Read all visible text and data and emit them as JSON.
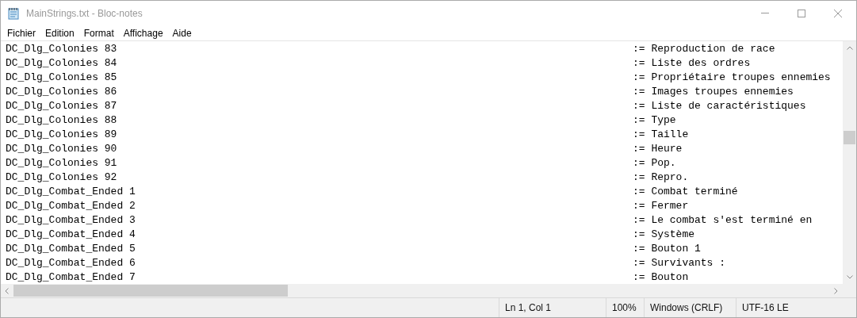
{
  "window": {
    "title": "MainStrings.txt - Bloc-notes"
  },
  "menu": [
    "Fichier",
    "Edition",
    "Format",
    "Affichage",
    "Aide"
  ],
  "lines": [
    {
      "key": "DC_Dlg_Colonies 83",
      "value": ":= Reproduction de race"
    },
    {
      "key": "DC_Dlg_Colonies 84",
      "value": ":= Liste des ordres"
    },
    {
      "key": "DC_Dlg_Colonies 85",
      "value": ":= Propriétaire troupes ennemies"
    },
    {
      "key": "DC_Dlg_Colonies 86",
      "value": ":= Images troupes ennemies"
    },
    {
      "key": "DC_Dlg_Colonies 87",
      "value": ":= Liste de caractéristiques"
    },
    {
      "key": "DC_Dlg_Colonies 88",
      "value": ":= Type"
    },
    {
      "key": "DC_Dlg_Colonies 89",
      "value": ":= Taille"
    },
    {
      "key": "DC_Dlg_Colonies 90",
      "value": ":= Heure"
    },
    {
      "key": "DC_Dlg_Colonies 91",
      "value": ":= Pop."
    },
    {
      "key": "DC_Dlg_Colonies 92",
      "value": ":= Repro."
    },
    {
      "key": "DC_Dlg_Combat_Ended 1",
      "value": ":= Combat terminé"
    },
    {
      "key": "DC_Dlg_Combat_Ended 2",
      "value": ":= Fermer"
    },
    {
      "key": "DC_Dlg_Combat_Ended 3",
      "value": ":= Le combat s'est terminé en"
    },
    {
      "key": "DC_Dlg_Combat_Ended 4",
      "value": ":= Système"
    },
    {
      "key": "DC_Dlg_Combat_Ended 5",
      "value": ":= Bouton 1"
    },
    {
      "key": "DC_Dlg_Combat_Ended 6",
      "value": ":= Survivants :"
    },
    {
      "key": "DC_Dlg_Combat_Ended 7",
      "value": ":= Bouton"
    }
  ],
  "status_bar": [
    "Ln 1, Col 1",
    "100%",
    "Windows (CRLF)",
    "UTF-16 LE"
  ]
}
